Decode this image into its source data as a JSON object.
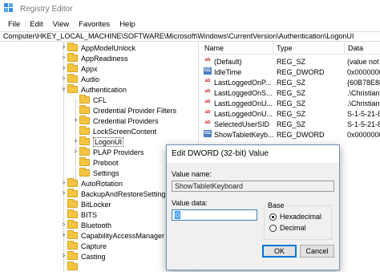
{
  "window": {
    "title": "Registry Editor"
  },
  "menu": [
    "File",
    "Edit",
    "View",
    "Favorites",
    "Help"
  ],
  "address": "Computer\\HKEY_LOCAL_MACHINE\\SOFTWARE\\Microsoft\\Windows\\CurrentVersion\\Authentication\\LogonUI",
  "tree": [
    {
      "label": "AppModelUnlock",
      "expander": ">"
    },
    {
      "label": "AppReadiness",
      "expander": ">"
    },
    {
      "label": "Appx",
      "expander": ">"
    },
    {
      "label": "Audio",
      "expander": ">"
    },
    {
      "label": "Authentication",
      "expander": "v"
    },
    {
      "label": "CFL",
      "expander": ""
    },
    {
      "label": "Credential Provider Filters",
      "expander": ""
    },
    {
      "label": "Credential Providers",
      "expander": ">"
    },
    {
      "label": "LockScreenContent",
      "expander": ""
    },
    {
      "label": "LogonUI",
      "expander": ">",
      "selected": true
    },
    {
      "label": "PLAP Providers",
      "expander": ">"
    },
    {
      "label": "Preboot",
      "expander": ""
    },
    {
      "label": "Settings",
      "expander": ""
    },
    {
      "label": "AutoRotation",
      "expander": ">"
    },
    {
      "label": "BackupAndRestoreSettings",
      "expander": ">"
    },
    {
      "label": "BitLocker",
      "expander": ""
    },
    {
      "label": "BITS",
      "expander": ""
    },
    {
      "label": "Bluetooth",
      "expander": ">"
    },
    {
      "label": "CapabilityAccessManager",
      "expander": ">"
    },
    {
      "label": "Capture",
      "expander": ""
    },
    {
      "label": "Casting",
      "expander": ">"
    },
    {
      "label": "",
      "expander": ""
    }
  ],
  "values_pane": {
    "headers": [
      "Name",
      "Type",
      "Data"
    ],
    "rows": [
      {
        "icon": "string-value-icon",
        "glyph": "ab",
        "name": "(Default)",
        "type": "REG_SZ",
        "data": "(value not"
      },
      {
        "icon": "dword-value-icon",
        "glyph": "011",
        "name": "IdleTime",
        "type": "REG_DWORD",
        "data": "0x0000000"
      },
      {
        "icon": "string-value-icon",
        "glyph": "ab",
        "name": "LastLoggedOnP...",
        "type": "REG_SZ",
        "data": "{60B78E88-"
      },
      {
        "icon": "string-value-icon",
        "glyph": "ab",
        "name": "LastLoggedOnS...",
        "type": "REG_SZ",
        "data": ".\\Christian"
      },
      {
        "icon": "string-value-icon",
        "glyph": "ab",
        "name": "LastLoggedOnU...",
        "type": "REG_SZ",
        "data": ".\\Christian"
      },
      {
        "icon": "string-value-icon",
        "glyph": "ab",
        "name": "LastLoggedOnU...",
        "type": "REG_SZ",
        "data": "S-1-5-21-8"
      },
      {
        "icon": "string-value-icon",
        "glyph": "ab",
        "name": "SelectedUserSID",
        "type": "REG_SZ",
        "data": "S-1-5-21-8"
      },
      {
        "icon": "dword-value-icon",
        "glyph": "011",
        "name": "ShowTabletKeyb...",
        "type": "REG_DWORD",
        "data": "0x0000000"
      }
    ]
  },
  "dialog": {
    "title": "Edit DWORD (32-bit) Value",
    "value_name_label": "Value name:",
    "value_name": "ShowTabletKeyboard",
    "value_data_label": "Value data:",
    "value_data": "0",
    "base_label": "Base",
    "radio_hex": "Hexadecimal",
    "radio_dec": "Decimal",
    "ok": "OK",
    "cancel": "Cancel"
  },
  "colors": {
    "folder": "#f5c542",
    "dialog_border": "#6f8fb8",
    "default_button": "#0078d7",
    "selection": "#3399ff"
  }
}
